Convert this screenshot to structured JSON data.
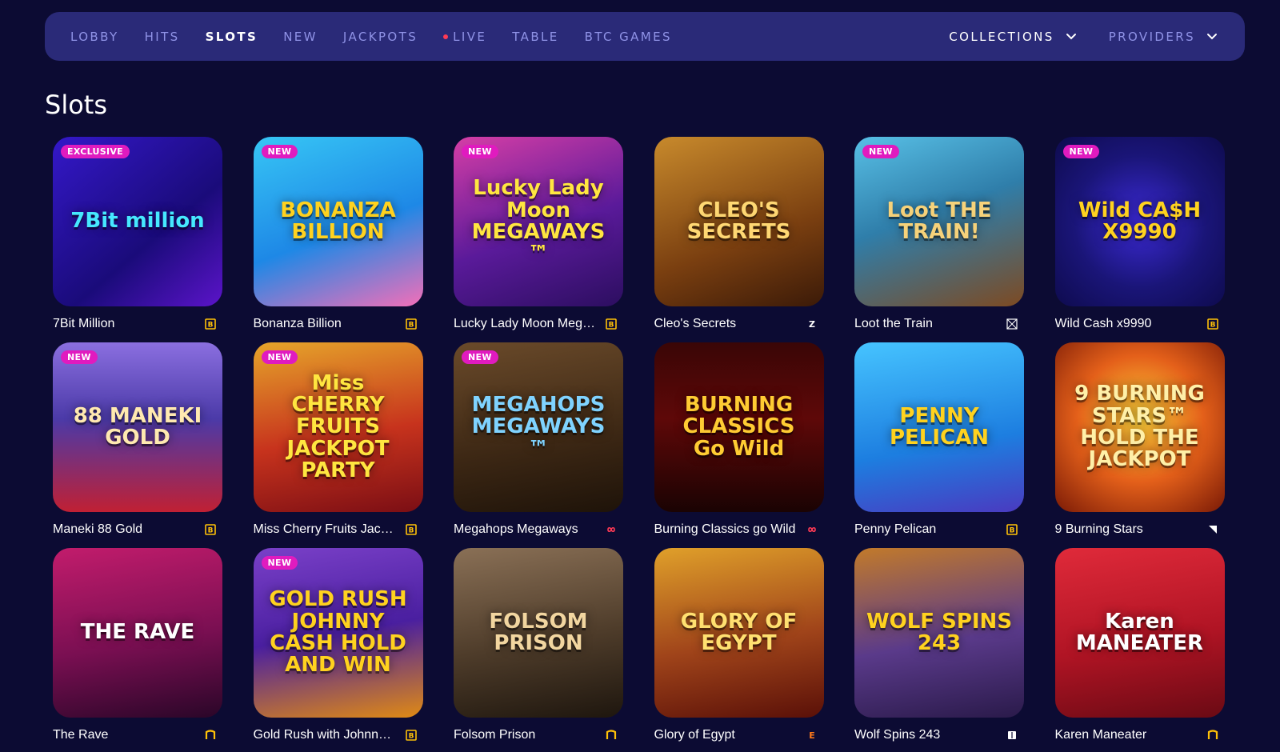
{
  "nav": {
    "items": [
      {
        "label": "LOBBY",
        "active": false
      },
      {
        "label": "HITS",
        "active": false
      },
      {
        "label": "SLOTS",
        "active": true
      },
      {
        "label": "NEW",
        "active": false
      },
      {
        "label": "JACKPOTS",
        "active": false
      },
      {
        "label": "LIVE",
        "active": false,
        "live": true
      },
      {
        "label": "TABLE",
        "active": false
      },
      {
        "label": "BTC GAMES",
        "active": false
      }
    ],
    "collections": "COLLECTIONS",
    "providers": "PROVIDERS"
  },
  "page": {
    "title": "Slots"
  },
  "colors": {
    "background": "#0c0b33",
    "navbar": "#2a2a78",
    "nav_text": "#8f92e6",
    "badge": "#e01bbf"
  },
  "games": [
    {
      "name": "7Bit Million",
      "badge": "EXCLUSIVE",
      "art": "7Bit million",
      "bg": "linear-gradient(140deg,#3418c9,#1a0b7a 60%,#5b14c9)",
      "fg": "#46e8ff",
      "icon": "provider-b-icon"
    },
    {
      "name": "Bonanza Billion",
      "badge": "NEW",
      "art": "BONANZA BILLION",
      "bg": "linear-gradient(160deg,#37c6f5,#1e88e6 55%,#f36fb8)",
      "fg": "#ffd21f",
      "icon": "provider-b-icon"
    },
    {
      "name": "Lucky Lady Moon Mega...",
      "badge": "NEW",
      "art": "Lucky Lady Moon MEGAWAYS™",
      "bg": "linear-gradient(160deg,#d63ea6,#5a1a9a 55%,#2c0e60)",
      "fg": "#ffe640",
      "icon": "provider-b-icon"
    },
    {
      "name": "Cleo's Secrets",
      "badge": "",
      "art": "CLEO'S SECRETS",
      "bg": "linear-gradient(160deg,#c88a2c,#7a3f10 60%,#3b1a08)",
      "fg": "#ffd873",
      "icon": "provider-z-icon"
    },
    {
      "name": "Loot the Train",
      "badge": "NEW",
      "art": "Loot THE TRAIN!",
      "bg": "linear-gradient(160deg,#58c0e6,#2f7eaa 45%,#7d4a22)",
      "fg": "#f6d27a",
      "icon": "provider-grid-icon"
    },
    {
      "name": "Wild Cash x9990",
      "badge": "NEW",
      "art": "Wild CA$H X9990",
      "bg": "radial-gradient(circle at 50% 50%,#3c2ad6,#1a1578 55%,#0e0b4e)",
      "fg": "#ffd21f",
      "icon": "provider-b-icon"
    },
    {
      "name": "Maneki 88 Gold",
      "badge": "NEW",
      "art": "88 MANEKI GOLD",
      "bg": "linear-gradient(180deg,#8b6fe0,#4b3aa8 45%,#c02034)",
      "fg": "#ffe9b0",
      "icon": "provider-b-icon"
    },
    {
      "name": "Miss Cherry Fruits Jackp...",
      "badge": "NEW",
      "art": "Miss CHERRY FRUITS JACKPOT PARTY",
      "bg": "linear-gradient(170deg,#e6a52a,#c7331d 55%,#7b0e14)",
      "fg": "#ffe640",
      "icon": "provider-b-icon"
    },
    {
      "name": "Megahops Megaways",
      "badge": "NEW",
      "art": "MEGAHOPS MEGAWAYS™",
      "bg": "linear-gradient(170deg,#6a4a2a,#3c2714 60%,#1e1309)",
      "fg": "#7fd3ff",
      "icon": "provider-infinity-icon"
    },
    {
      "name": "Burning Classics go Wild",
      "badge": "",
      "art": "BURNING CLASSICS Go Wild",
      "bg": "linear-gradient(180deg,#3a0606,#5e0808 45%,#1a0303)",
      "fg": "#ffcc33",
      "icon": "provider-infinity-icon"
    },
    {
      "name": "Penny Pelican",
      "badge": "",
      "art": "PENNY PELICAN",
      "bg": "linear-gradient(170deg,#46c4ff,#1d7ee0 60%,#4a3ac0)",
      "fg": "#ffd21f",
      "icon": "provider-b-icon"
    },
    {
      "name": "9 Burning Stars",
      "badge": "",
      "art": "9 BURNING STARS™ HOLD THE JACKPOT",
      "bg": "radial-gradient(circle at 50% 45%,#ffd23a,#e4601a 50%,#7a1a06)",
      "fg": "#fff0a8",
      "icon": "provider-corner-icon"
    },
    {
      "name": "The Rave",
      "badge": "",
      "art": "THE RAVE",
      "bg": "linear-gradient(170deg,#c21c6c,#7a0f52 55%,#2a0628)",
      "fg": "#ffffff",
      "icon": "provider-n-icon"
    },
    {
      "name": "Gold Rush with Johnny ...",
      "badge": "NEW",
      "art": "GOLD RUSH JOHNNY CASH HOLD AND WIN",
      "bg": "linear-gradient(170deg,#7a40c8,#4a1fa0 50%,#e08a14)",
      "fg": "#ffd21f",
      "icon": "provider-b-icon"
    },
    {
      "name": "Folsom Prison",
      "badge": "",
      "art": "FOLSOM PRISON",
      "bg": "linear-gradient(170deg,#8a7056,#4e3c2a 55%,#1e160e)",
      "fg": "#f2d6a0",
      "icon": "provider-n-icon"
    },
    {
      "name": "Glory of Egypt",
      "badge": "",
      "art": "GLORY OF EGYPT",
      "bg": "linear-gradient(170deg,#e0a02a,#a0441a 55%,#5a1008)",
      "fg": "#ffe070",
      "icon": "provider-e-icon"
    },
    {
      "name": "Wolf Spins 243",
      "badge": "",
      "art": "WOLF SPINS 243",
      "bg": "linear-gradient(170deg,#c27a2a,#5a3a8a 55%,#2a1a4a)",
      "fg": "#ffd21f",
      "icon": "provider-book-icon"
    },
    {
      "name": "Karen Maneater",
      "badge": "",
      "art": "Karen MANEATER",
      "bg": "linear-gradient(170deg,#e02a3a,#b01424 55%,#6a0a14)",
      "fg": "#ffffff",
      "icon": "provider-n-icon"
    }
  ]
}
